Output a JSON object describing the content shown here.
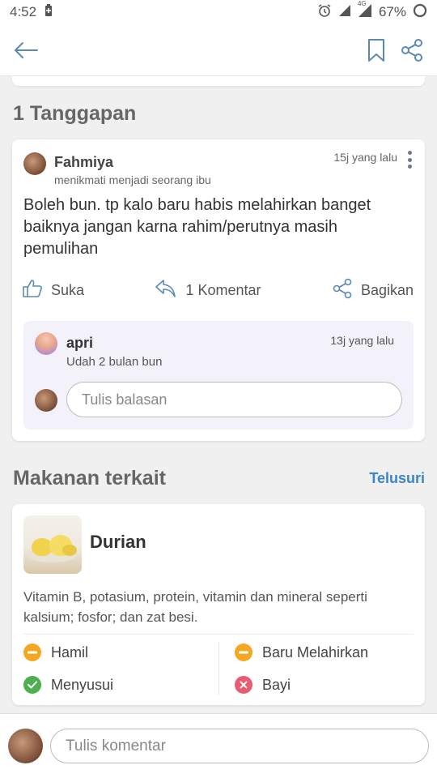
{
  "status_bar": {
    "time": "4:52",
    "network": "4G",
    "battery": "67%"
  },
  "app_bar": {
    "back_icon": "arrow-left-icon",
    "bookmark_icon": "bookmark-icon",
    "share_icon": "share-icon"
  },
  "responses": {
    "title": "1 Tanggapan",
    "comment": {
      "author": "Fahmiya",
      "bio": "menikmati menjadi seorang ibu",
      "time": "15j yang lalu",
      "text": "Boleh bun. tp kalo baru habis melahirkan banget baiknya jangan karna rahim/perutnya masih pemulihan",
      "actions": {
        "like": "Suka",
        "reply": "1 Komentar",
        "share": "Bagikan"
      },
      "reply": {
        "author": "apri",
        "time": "13j yang lalu",
        "text": "Udah 2 bulan  bun",
        "input_placeholder": "Tulis balasan"
      }
    }
  },
  "related_food": {
    "title": "Makanan terkait",
    "explore_label": "Telusuri",
    "item": {
      "name": "Durian",
      "description": "Vitamin B, potasium, protein, vitamin dan mineral seperti kalsium; fosfor; dan zat besi.",
      "statuses": [
        {
          "label": "Hamil",
          "status": "caution",
          "color": "#f5a623"
        },
        {
          "label": "Baru Melahirkan",
          "status": "caution",
          "color": "#f5a623"
        },
        {
          "label": "Menyusui",
          "status": "safe",
          "color": "#4caf50"
        },
        {
          "label": "Bayi",
          "status": "avoid",
          "color": "#ea5b6e"
        }
      ]
    }
  },
  "bottom_bar": {
    "input_placeholder": "Tulis komentar"
  },
  "colors": {
    "accent": "#3a86c8",
    "icon": "#5b89b5"
  }
}
